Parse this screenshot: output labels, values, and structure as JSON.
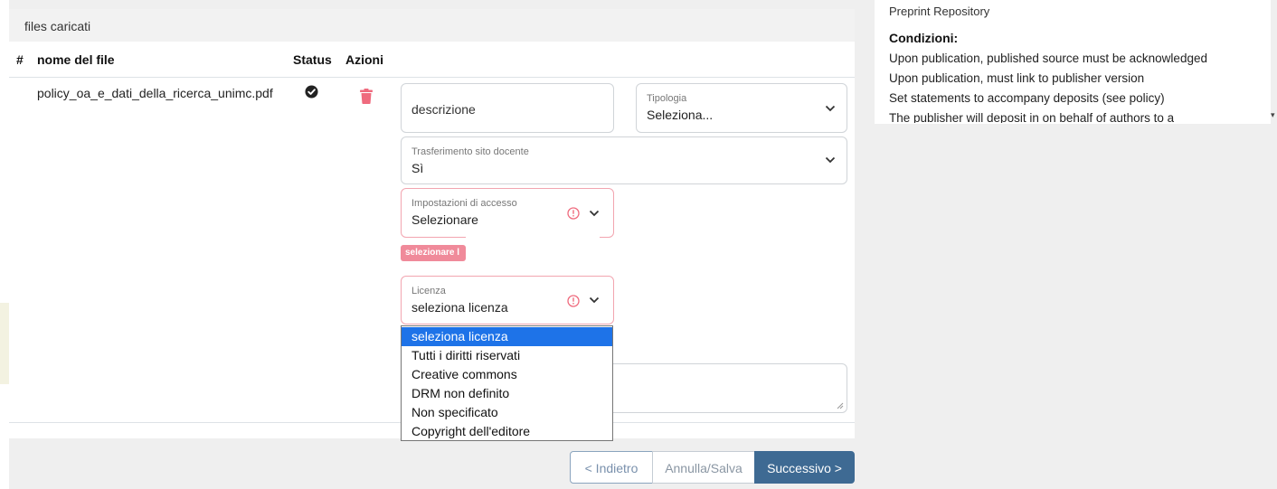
{
  "files_panel": {
    "header": "files caricati",
    "columns": [
      "#",
      "nome del file",
      "Status",
      "Azioni"
    ],
    "file": {
      "name": "policy_oa_e_dati_della_ricerca_unimc.pdf",
      "status_icon": "check-circle-icon",
      "action_icon": "trash-icon"
    }
  },
  "form": {
    "descrizione": "descrizione",
    "tipologia": {
      "label": "Tipologia",
      "value": "Seleziona..."
    },
    "trasferimento": {
      "label": "Trasferimento sito docente",
      "value": "Sì"
    },
    "accesso": {
      "label": "Impostazioni di accesso",
      "value": "Selezionare"
    },
    "error_badge": "selezionare l",
    "licenza": {
      "label": "Licenza",
      "value": "seleziona licenza"
    },
    "licenza_options": [
      "seleziona licenza",
      "Tutti i diritti riservati",
      "Creative commons",
      "DRM non definito",
      "Non specificato",
      "Copyright dell'editore"
    ],
    "licenza_selected_index": 0
  },
  "nav": {
    "back": "< Indietro",
    "save": "Annulla/Salva",
    "next": "Successivo >"
  },
  "policy": {
    "preprint": "Preprint Repository",
    "heading": "Condizioni:",
    "conditions": [
      "Upon publication, published source must be acknowledged",
      "Upon publication, must link to publisher version",
      "Set statements to accompany deposits (see policy)",
      "The publisher will deposit in on behalf of authors to a"
    ]
  },
  "colors": {
    "accent": "#3e6a93",
    "error": "#f08a9a",
    "selected_option": "#1e73e8",
    "trash": "#ef6b7e"
  }
}
